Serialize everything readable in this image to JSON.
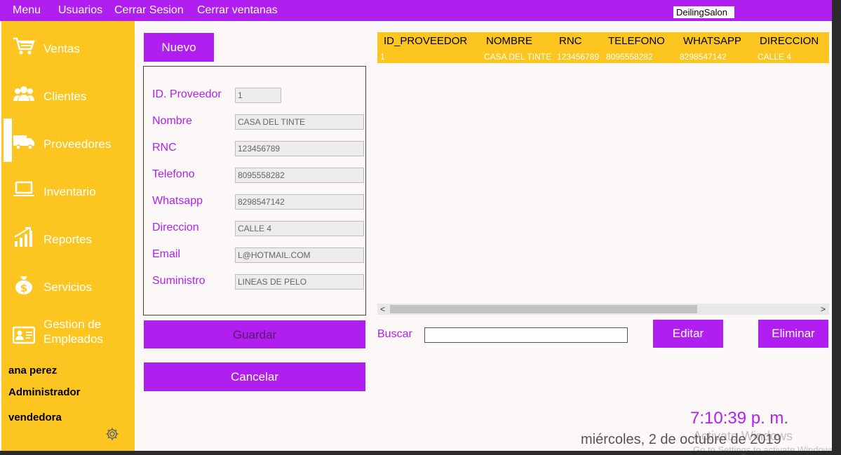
{
  "menubar": {
    "items": [
      "Menu",
      "Usuarios",
      "Cerrar Sesion",
      "Cerrar ventanas"
    ],
    "brand": "DeilingSalon"
  },
  "sidebar": {
    "items": [
      {
        "label": "Ventas",
        "icon": "cart-icon"
      },
      {
        "label": "Clientes",
        "icon": "users-icon"
      },
      {
        "label": "Proveedores",
        "icon": "truck-icon"
      },
      {
        "label": "Inventario",
        "icon": "laptop-icon"
      },
      {
        "label": "Reportes",
        "icon": "bar-chart-icon"
      },
      {
        "label": "Servicios",
        "icon": "money-bag-icon"
      },
      {
        "label": "Gestion de Empleados",
        "icon": "id-card-icon"
      }
    ],
    "active": "Proveedores",
    "user": {
      "name": "ana perez",
      "role": "Administrador",
      "position": "vendedora"
    },
    "settings_icon": "gear-icon"
  },
  "buttons": {
    "nuevo": "Nuevo",
    "guardar": "Guardar",
    "cancelar": "Cancelar",
    "editar": "Editar",
    "eliminar": "Eliminar"
  },
  "form": {
    "id": {
      "label": "ID. Proveedor",
      "value": "1"
    },
    "nombre": {
      "label": "Nombre",
      "value": "CASA DEL TINTE"
    },
    "rnc": {
      "label": "RNC",
      "value": "123456789"
    },
    "telefono": {
      "label": "Telefono",
      "value": "8095558282"
    },
    "whatsapp": {
      "label": "Whatsapp",
      "value": "8298547142"
    },
    "direccion": {
      "label": "Direccion",
      "value": "CALLE 4"
    },
    "email": {
      "label": "Email",
      "value": "L@HOTMAIL.COM"
    },
    "suministro": {
      "label": "Suministro",
      "value": "LINEAS DE PELO"
    }
  },
  "grid": {
    "columns": [
      "ID_PROVEEDOR",
      "NOMBRE",
      "RNC",
      "TELEFONO",
      "WHATSAPP",
      "DIRECCION"
    ],
    "rows": [
      [
        "1",
        "CASA DEL TINTE",
        "123456789",
        "8095558282",
        "8298547142",
        "CALLE 4"
      ]
    ]
  },
  "search": {
    "label": "Buscar",
    "value": ""
  },
  "status": {
    "time": "7:10:39 p. m.",
    "date": "miércoles, 2 de octubre de 2019"
  },
  "watermark": {
    "line1": "Activate Windows",
    "line2": "Go to Settings to activate Windows."
  },
  "colors": {
    "accent": "#b11ef0",
    "sidebar": "#fcc520",
    "background": "#fcf8f8"
  }
}
